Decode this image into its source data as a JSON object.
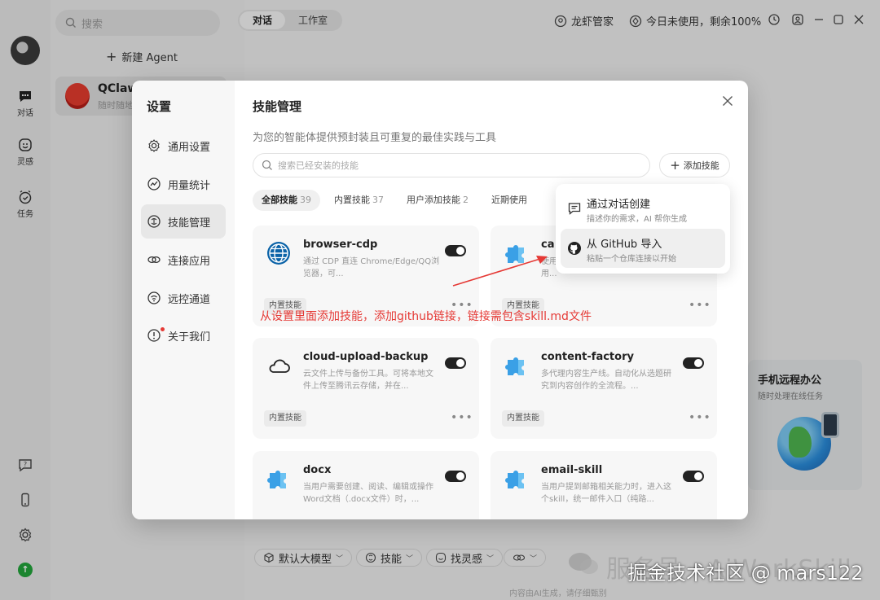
{
  "app": {
    "search_placeholder": "搜索",
    "new_agent": "新建 Agent",
    "agent": {
      "name": "QClaw",
      "sub": "随时随地"
    },
    "rail": {
      "chat": "对话",
      "inspiration": "灵感",
      "tasks": "任务"
    },
    "top_tabs": [
      "对话",
      "工作室"
    ],
    "top_right": {
      "manager": "龙虾管家",
      "usage": "今日未使用，剩余100%"
    },
    "promo": {
      "title": "手机远程办公",
      "sub": "随时处理在线任务"
    },
    "composer": {
      "model": "默认大模型",
      "skills": "技能",
      "inspiration": "找灵感"
    },
    "footnote": "内容由AI生成，请仔细甄别",
    "watermark": "服务号 · AiWorkSkill",
    "credit": "掘金技术社区 @ mars122"
  },
  "settings": {
    "title": "设置",
    "nav": [
      {
        "label": "通用设置",
        "icon": "gear-icon"
      },
      {
        "label": "用量统计",
        "icon": "chart-icon"
      },
      {
        "label": "技能管理",
        "icon": "brain-icon"
      },
      {
        "label": "连接应用",
        "icon": "link-icon"
      },
      {
        "label": "远控通道",
        "icon": "remote-icon"
      },
      {
        "label": "关于我们",
        "icon": "info-icon"
      }
    ],
    "active_nav": "技能管理"
  },
  "skills": {
    "title": "技能管理",
    "description": "为您的智能体提供预封装且可重复的最佳实践与工具",
    "search_placeholder": "搜索已经安装的技能",
    "add_button": "添加技能",
    "filters": [
      {
        "label": "全部技能",
        "count": "39"
      },
      {
        "label": "内置技能",
        "count": "37"
      },
      {
        "label": "用户添加技能",
        "count": "2"
      },
      {
        "label": "近期使用",
        "count": ""
      }
    ],
    "cards": [
      {
        "name": "browser-cdp",
        "desc": "通过 CDP 直连 Chrome/Edge/QQ浏览器，可...",
        "badge": "内置技能",
        "enabled": true,
        "icon": "globe-icon"
      },
      {
        "name": "ca",
        "desc": "使用... 创作实施的视频工作流程。当用...",
        "badge": "内置技能",
        "enabled": true,
        "icon": "puzzle-icon"
      },
      {
        "name": "cloud-upload-backup",
        "desc": "云文件上传与备份工具。可将本地文件上传至腾讯云存储，并在...",
        "badge": "内置技能",
        "enabled": true,
        "icon": "cloud-icon"
      },
      {
        "name": "content-factory",
        "desc": "多代理内容生产线。自动化从选题研究到内容创作的全流程。...",
        "badge": "内置技能",
        "enabled": true,
        "icon": "puzzle-icon"
      },
      {
        "name": "docx",
        "desc": "当用户需要创建、阅读、编辑或操作Word文档（.docx文件）时，...",
        "badge": "",
        "enabled": true,
        "icon": "puzzle-icon"
      },
      {
        "name": "email-skill",
        "desc": "当用户提到邮箱相关能力时，进入这个skill，统一邮件入口（纯路...",
        "badge": "",
        "enabled": true,
        "icon": "puzzle-icon"
      }
    ],
    "dropdown": [
      {
        "title": "通过对话创建",
        "sub": "描述你的需求，AI 帮你生成",
        "icon": "chat-bubble-icon"
      },
      {
        "title": "从 GitHub 导入",
        "sub": "粘贴一个仓库连接以开始",
        "icon": "github-icon"
      }
    ]
  },
  "annotation": "从设置里面添加技能，添加github链接，链接需包含skill.md文件",
  "colors": {
    "annotation": "#e53935",
    "toggle_on": "#222222",
    "modal_bg": "#ffffff",
    "nav_bg": "#f7f7f7"
  }
}
